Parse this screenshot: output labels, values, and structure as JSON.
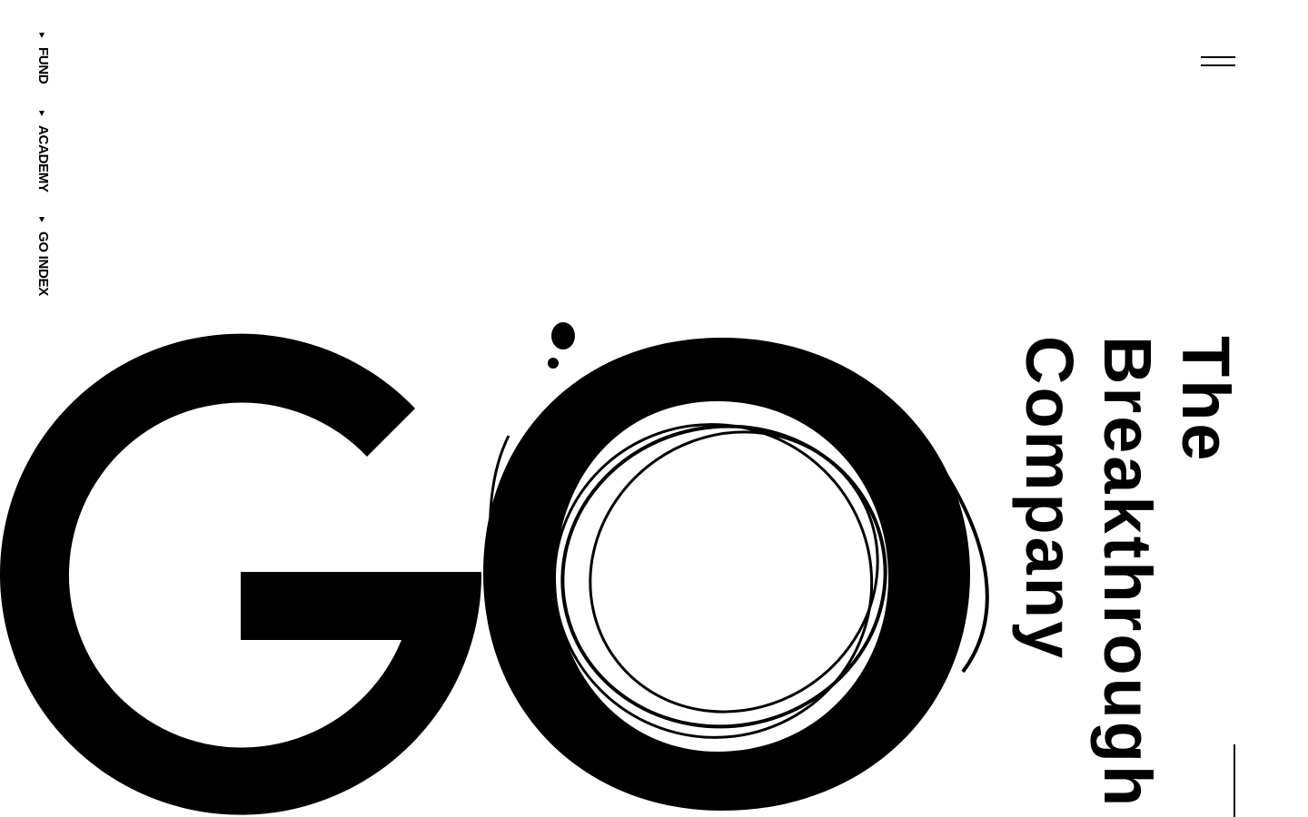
{
  "nav": {
    "items": [
      {
        "label": "FUND",
        "icon": "caret-down-icon"
      },
      {
        "label": "ACADEMY",
        "icon": "caret-down-icon"
      },
      {
        "label": "GO INDEX",
        "icon": "caret-down-icon"
      }
    ]
  },
  "menu": {
    "icon": "hamburger-icon"
  },
  "logo": {
    "text": "GO"
  },
  "tagline": {
    "lines": [
      "The",
      "Breakthrough",
      "Company"
    ]
  },
  "colors": {
    "background": "#ffffff",
    "foreground": "#000000"
  }
}
